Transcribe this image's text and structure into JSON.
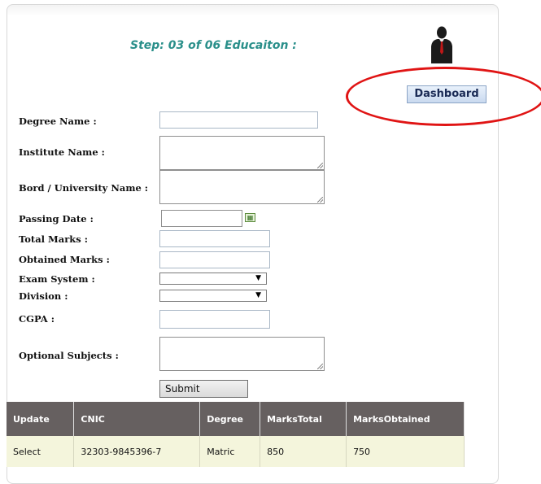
{
  "header": {
    "step_title": "Step: 03 of 06 Educaiton :",
    "dashboard_label": "Dashboard"
  },
  "form": {
    "degree_name_label": "Degree Name :",
    "institute_name_label": "Institute Name :",
    "board_university_label": "Bord / University Name :",
    "passing_date_label": "Passing Date :",
    "total_marks_label": "Total Marks :",
    "obtained_marks_label": "Obtained Marks :",
    "exam_system_label": "Exam System :",
    "division_label": "Division :",
    "cgpa_label": "CGPA :",
    "optional_subjects_label": "Optional Subjects :",
    "submit_label": "Submit"
  },
  "table": {
    "headers": [
      "Update",
      "CNIC",
      "Degree",
      "MarksTotal",
      "MarksObtained"
    ],
    "rows": [
      [
        "Select",
        "32303-9845396-7",
        "Matric",
        "850",
        "750"
      ]
    ]
  },
  "colors": {
    "title_teal": "#2a8f8a",
    "highlight_red": "#e01414",
    "table_header": "#666060",
    "table_row": "#f4f5dc"
  }
}
